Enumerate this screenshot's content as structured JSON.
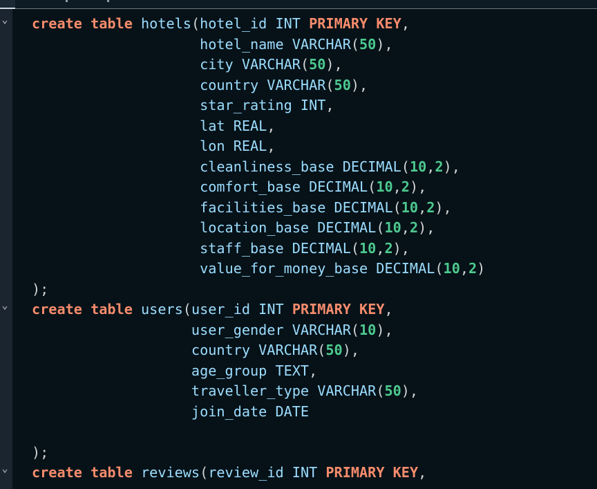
{
  "editor": {
    "fold_marker": "⌄",
    "lines": [
      {
        "s": [
          {
            "t": "create table",
            "c": "kw"
          },
          {
            "t": " hotels",
            "c": "id"
          },
          {
            "t": "(",
            "c": "pun"
          },
          {
            "t": "hotel_id INT ",
            "c": "id"
          },
          {
            "t": "PRIMARY KEY",
            "c": "kw"
          },
          {
            "t": ",",
            "c": "pun"
          }
        ]
      },
      {
        "s": [
          {
            "t": "                    hotel_name VARCHAR",
            "c": "id"
          },
          {
            "t": "(",
            "c": "pun"
          },
          {
            "t": "50",
            "c": "num"
          },
          {
            "t": "),",
            "c": "pun"
          }
        ]
      },
      {
        "s": [
          {
            "t": "                    city VARCHAR",
            "c": "id"
          },
          {
            "t": "(",
            "c": "pun"
          },
          {
            "t": "50",
            "c": "num"
          },
          {
            "t": "),",
            "c": "pun"
          }
        ]
      },
      {
        "s": [
          {
            "t": "                    country VARCHAR",
            "c": "id"
          },
          {
            "t": "(",
            "c": "pun"
          },
          {
            "t": "50",
            "c": "num"
          },
          {
            "t": "),",
            "c": "pun"
          }
        ]
      },
      {
        "s": [
          {
            "t": "                    star_rating INT",
            "c": "id"
          },
          {
            "t": ",",
            "c": "pun"
          }
        ]
      },
      {
        "s": [
          {
            "t": "                    lat REAL",
            "c": "id"
          },
          {
            "t": ",",
            "c": "pun"
          }
        ]
      },
      {
        "s": [
          {
            "t": "                    lon REAL",
            "c": "id"
          },
          {
            "t": ",",
            "c": "pun"
          }
        ]
      },
      {
        "s": [
          {
            "t": "                    cleanliness_base DECIMAL",
            "c": "id"
          },
          {
            "t": "(",
            "c": "pun"
          },
          {
            "t": "10",
            "c": "num"
          },
          {
            "t": ",",
            "c": "pun"
          },
          {
            "t": "2",
            "c": "num"
          },
          {
            "t": "),",
            "c": "pun"
          }
        ]
      },
      {
        "s": [
          {
            "t": "                    comfort_base DECIMAL",
            "c": "id"
          },
          {
            "t": "(",
            "c": "pun"
          },
          {
            "t": "10",
            "c": "num"
          },
          {
            "t": ",",
            "c": "pun"
          },
          {
            "t": "2",
            "c": "num"
          },
          {
            "t": "),",
            "c": "pun"
          }
        ]
      },
      {
        "s": [
          {
            "t": "                    facilities_base DECIMAL",
            "c": "id"
          },
          {
            "t": "(",
            "c": "pun"
          },
          {
            "t": "10",
            "c": "num"
          },
          {
            "t": ",",
            "c": "pun"
          },
          {
            "t": "2",
            "c": "num"
          },
          {
            "t": "),",
            "c": "pun"
          }
        ]
      },
      {
        "s": [
          {
            "t": "                    location_base DECIMAL",
            "c": "id"
          },
          {
            "t": "(",
            "c": "pun"
          },
          {
            "t": "10",
            "c": "num"
          },
          {
            "t": ",",
            "c": "pun"
          },
          {
            "t": "2",
            "c": "num"
          },
          {
            "t": "),",
            "c": "pun"
          }
        ]
      },
      {
        "s": [
          {
            "t": "                    staff_base DECIMAL",
            "c": "id"
          },
          {
            "t": "(",
            "c": "pun"
          },
          {
            "t": "10",
            "c": "num"
          },
          {
            "t": ",",
            "c": "pun"
          },
          {
            "t": "2",
            "c": "num"
          },
          {
            "t": "),",
            "c": "pun"
          }
        ]
      },
      {
        "s": [
          {
            "t": "                    value_for_money_base DECIMAL",
            "c": "id"
          },
          {
            "t": "(",
            "c": "pun"
          },
          {
            "t": "10",
            "c": "num"
          },
          {
            "t": ",",
            "c": "pun"
          },
          {
            "t": "2",
            "c": "num"
          },
          {
            "t": ")",
            "c": "pun"
          }
        ]
      },
      {
        "s": [
          {
            "t": ");",
            "c": "pun"
          }
        ]
      },
      {
        "s": [
          {
            "t": "create table",
            "c": "kw"
          },
          {
            "t": " users",
            "c": "id"
          },
          {
            "t": "(",
            "c": "pun"
          },
          {
            "t": "user_id INT ",
            "c": "id"
          },
          {
            "t": "PRIMARY KEY",
            "c": "kw"
          },
          {
            "t": ",",
            "c": "pun"
          }
        ]
      },
      {
        "s": [
          {
            "t": "                   user_gender VARCHAR",
            "c": "id"
          },
          {
            "t": "(",
            "c": "pun"
          },
          {
            "t": "10",
            "c": "num"
          },
          {
            "t": "),",
            "c": "pun"
          }
        ]
      },
      {
        "s": [
          {
            "t": "                   country VARCHAR",
            "c": "id"
          },
          {
            "t": "(",
            "c": "pun"
          },
          {
            "t": "50",
            "c": "num"
          },
          {
            "t": "),",
            "c": "pun"
          }
        ]
      },
      {
        "s": [
          {
            "t": "                   age_group TEXT",
            "c": "id"
          },
          {
            "t": ",",
            "c": "pun"
          }
        ]
      },
      {
        "s": [
          {
            "t": "                   traveller_type VARCHAR",
            "c": "id"
          },
          {
            "t": "(",
            "c": "pun"
          },
          {
            "t": "50",
            "c": "num"
          },
          {
            "t": "),",
            "c": "pun"
          }
        ]
      },
      {
        "s": [
          {
            "t": "                   join_date DATE",
            "c": "id"
          }
        ]
      },
      {
        "s": []
      },
      {
        "s": [
          {
            "t": ");",
            "c": "pun"
          }
        ]
      },
      {
        "s": [
          {
            "t": "create table",
            "c": "kw"
          },
          {
            "t": " reviews",
            "c": "id"
          },
          {
            "t": "(",
            "c": "pun"
          },
          {
            "t": "review_id INT ",
            "c": "id"
          },
          {
            "t": "PRIMARY KEY",
            "c": "kw"
          },
          {
            "t": ",",
            "c": "pun"
          }
        ]
      }
    ],
    "fold_lines": [
      0,
      14,
      22
    ]
  },
  "colors": {
    "background": "#061218",
    "keyword": "#f78c6c",
    "identifier": "#9cdcfe",
    "number": "#4ec98f",
    "punctuation": "#d4d4d4"
  }
}
